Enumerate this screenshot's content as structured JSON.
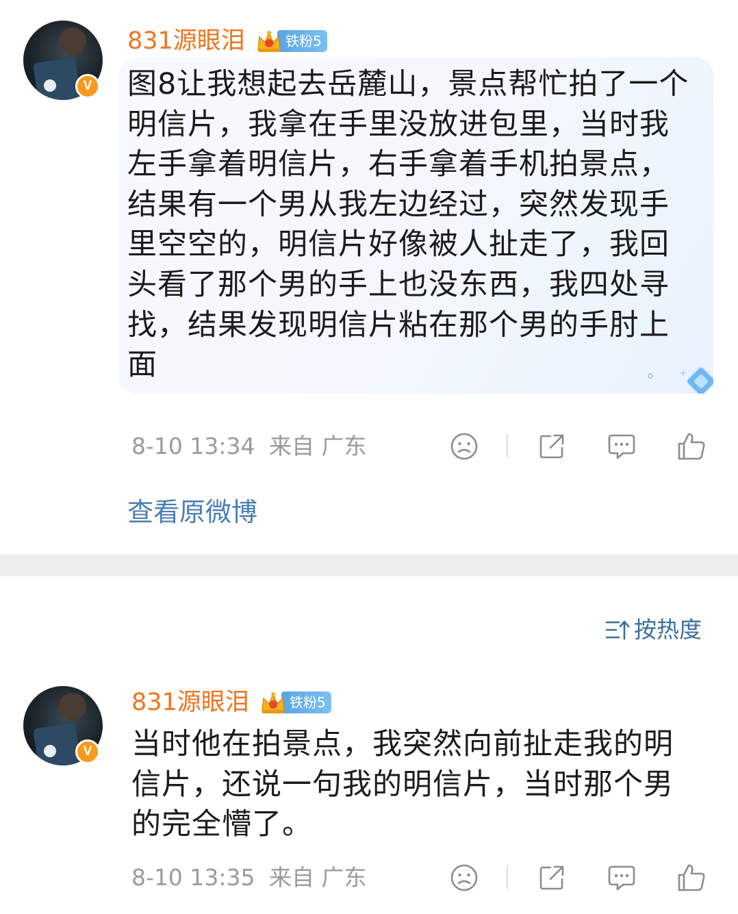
{
  "comments": [
    {
      "username": "831源眼泪",
      "fan_badge": "铁粉5",
      "verified_badge": "V",
      "text": "图8让我想起去岳麓山，景点帮忙拍了一个明信片，我拿在手里没放进包里，当时我左手拿着明信片，右手拿着手机拍景点，结果有一个男从我左边经过，突然发现手里空空的，明信片好像被人扯走了，我回头看了那个男的手上也没东西，我四处寻找，结果发现明信片粘在那个男的手肘上面",
      "timestamp": "8-10 13:34",
      "source": "来自 广东"
    },
    {
      "username": "831源眼泪",
      "fan_badge": "铁粉5",
      "verified_badge": "V",
      "text": "当时他在拍景点，我突然向前扯走我的明信片，还说一句我的明信片，当时那个男的完全懵了。",
      "timestamp": "8-10 13:35",
      "source": "来自 广东"
    }
  ],
  "view_original_link": "查看原微博",
  "sort_label": "按热度",
  "colors": {
    "username": "#f2731e",
    "link": "#4a7eb2",
    "sort": "#3c6e9e",
    "meta": "#9b9b9b",
    "verified": "#f79a1d",
    "fan_badge": "#5aa4e6"
  },
  "icons": [
    "sad-face-icon",
    "share-icon",
    "comment-icon",
    "like-icon",
    "sort-icon",
    "crown-icon"
  ]
}
